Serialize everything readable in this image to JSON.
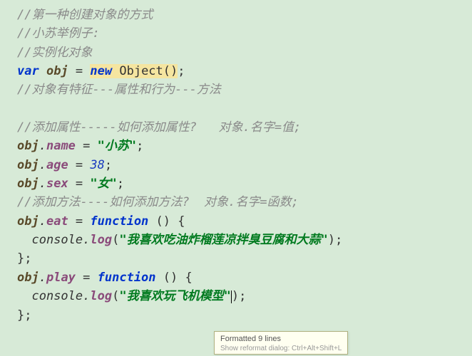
{
  "code": {
    "c1": "//第一种创建对象的方式",
    "c2": "//小苏举例子:",
    "c3": "//实例化对象",
    "varKw": "var",
    "objName": "obj",
    "eq": " = ",
    "newKw": "new",
    "objectClass": " Object()",
    "semi": ";",
    "c4": "//对象有特征---属性和行为---方法",
    "c5": "//添加属性-----如何添加属性?   对象.名字=值;",
    "dot": ".",
    "nameProp": "name",
    "nameVal": "\"小苏\"",
    "ageProp": "age",
    "ageVal": "38",
    "sexProp": "sex",
    "sexVal": "\"女\"",
    "c6": "//添加方法----如何添加方法?  对象.名字=函数;",
    "eatProp": "eat",
    "funcKw": "function",
    "funcHead": " () {",
    "consoleTok": "console",
    "logProp": "log",
    "open": "(",
    "close": ")",
    "eatLog": "\"我喜欢吃油炸榴莲凉拌臭豆腐和大蒜\"",
    "closeBrace": "};",
    "playProp": "play",
    "playLog": "\"我喜欢玩飞机模型\"",
    "indent2": "  ",
    "indent4": "    "
  },
  "tooltip": {
    "line1": "Formatted 9 lines",
    "line2": "Show reformat dialog: Ctrl+Alt+Shift+L"
  }
}
